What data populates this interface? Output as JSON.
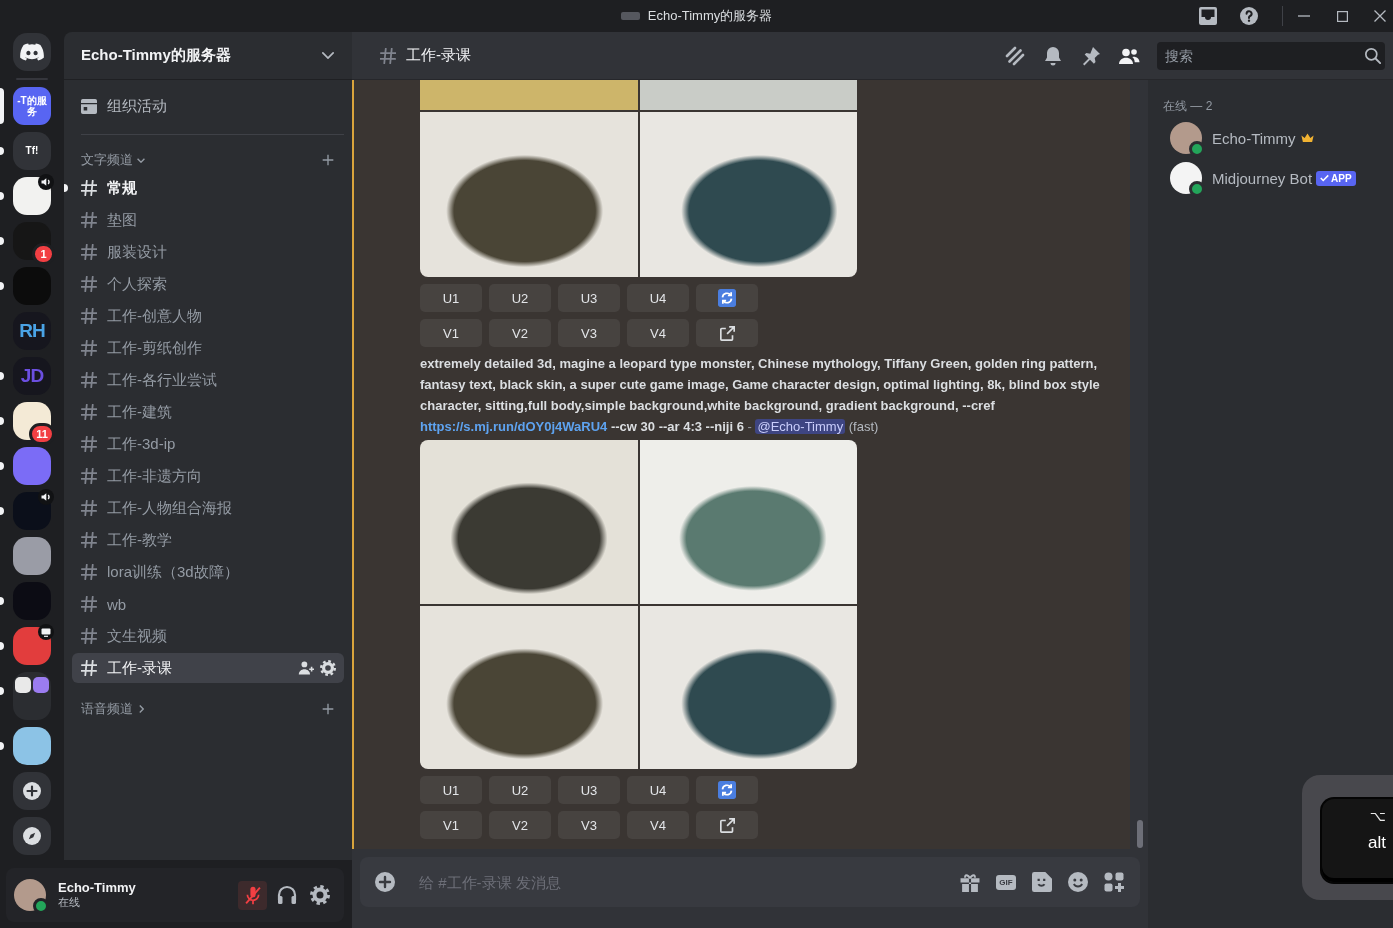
{
  "window": {
    "title": "Echo-Timmy的服务器"
  },
  "servers": [
    {
      "kind": "home",
      "selected": false,
      "unread": false,
      "voice": false,
      "screen": false
    },
    {
      "kind": "label",
      "label": "-T的服务",
      "color": "#5865f2",
      "selected": true,
      "unread": false,
      "voice": false,
      "screen": false
    },
    {
      "kind": "label",
      "label": "Tf!",
      "color": "#313338",
      "selected": false,
      "unread": true,
      "voice": false,
      "screen": false
    },
    {
      "kind": "image",
      "color": "#f2f2f0",
      "selected": false,
      "unread": true,
      "voice": true,
      "screen": false
    },
    {
      "kind": "image",
      "color": "#161616",
      "badge": "1",
      "selected": false,
      "unread": true,
      "voice": false,
      "screen": false
    },
    {
      "kind": "image",
      "color": "#0c0c0c",
      "selected": false,
      "unread": true,
      "voice": false,
      "screen": false
    },
    {
      "kind": "wordmark",
      "label": "RH",
      "color": "#4aa3e6",
      "selected": false,
      "unread": false,
      "voice": false,
      "screen": false
    },
    {
      "kind": "wordmark",
      "label": "JD",
      "color": "#6b4fe0",
      "selected": false,
      "unread": true,
      "voice": false,
      "screen": false
    },
    {
      "kind": "image",
      "color": "#f4ead6",
      "badge": "11",
      "selected": false,
      "unread": true,
      "voice": false,
      "screen": false
    },
    {
      "kind": "image",
      "color": "#7b6cf6",
      "selected": false,
      "unread": true,
      "voice": false,
      "screen": false
    },
    {
      "kind": "image",
      "color": "#0b0f1a",
      "selected": false,
      "unread": true,
      "voice": true,
      "screen": false
    },
    {
      "kind": "image",
      "color": "#9a9ca6",
      "selected": false,
      "unread": false,
      "voice": false,
      "screen": false
    },
    {
      "kind": "image",
      "color": "#0c0c14",
      "selected": false,
      "unread": true,
      "voice": false,
      "screen": false
    },
    {
      "kind": "image",
      "color": "#e23d3d",
      "selected": false,
      "unread": true,
      "voice": false,
      "screen": true
    },
    {
      "kind": "folder",
      "items": [
        {
          "color": "#e9e9e9"
        },
        {
          "color": "#9b7cf0"
        }
      ],
      "selected": false,
      "unread": true,
      "voice": false,
      "screen": false
    },
    {
      "kind": "image",
      "color": "#8cc3e6",
      "selected": false,
      "unread": true,
      "voice": false,
      "screen": false
    },
    {
      "kind": "add",
      "selected": false,
      "unread": false,
      "voice": false,
      "screen": false
    },
    {
      "kind": "discover",
      "selected": false,
      "unread": false,
      "voice": false,
      "screen": false
    }
  ],
  "sidebar": {
    "server_name": "Echo-Timmy的服务器",
    "event": "组织活动",
    "categories": [
      {
        "name": "文字频道",
        "expanded": true,
        "channels": [
          {
            "name": "常规",
            "unread": true,
            "selected": false
          },
          {
            "name": "垫图",
            "unread": false,
            "selected": false
          },
          {
            "name": "服装设计",
            "unread": false,
            "selected": false
          },
          {
            "name": "个人探索",
            "unread": false,
            "selected": false
          },
          {
            "name": "工作-创意人物",
            "unread": false,
            "selected": false
          },
          {
            "name": "工作-剪纸创作",
            "unread": false,
            "selected": false
          },
          {
            "name": "工作-各行业尝试",
            "unread": false,
            "selected": false
          },
          {
            "name": "工作-建筑",
            "unread": false,
            "selected": false
          },
          {
            "name": "工作-3d-ip",
            "unread": false,
            "selected": false
          },
          {
            "name": "工作-非遗方向",
            "unread": false,
            "selected": false
          },
          {
            "name": "工作-人物组合海报",
            "unread": false,
            "selected": false
          },
          {
            "name": "工作-教学",
            "unread": false,
            "selected": false
          },
          {
            "name": "lora训练（3d故障）",
            "unread": false,
            "selected": false
          },
          {
            "name": "wb",
            "unread": false,
            "selected": false
          },
          {
            "name": "文生视频",
            "unread": false,
            "selected": false
          },
          {
            "name": "工作-录课",
            "unread": false,
            "selected": true
          }
        ]
      },
      {
        "name": "语音频道",
        "expanded": false
      }
    ]
  },
  "user": {
    "name": "Echo-Timmy",
    "status": "在线",
    "online": true,
    "muted": true
  },
  "header": {
    "channel": "工作-录课",
    "members_open": true,
    "search_placeholder": "搜索"
  },
  "message": {
    "highlighted": true,
    "blocks": [
      {
        "kind": "grid",
        "cropped": true
      },
      {
        "kind": "buttons",
        "rows": [
          [
            {
              "kind": "text",
              "label": "U1"
            },
            {
              "kind": "text",
              "label": "U2"
            },
            {
              "kind": "text",
              "label": "U3"
            },
            {
              "kind": "text",
              "label": "U4"
            },
            {
              "kind": "refresh"
            }
          ],
          [
            {
              "kind": "text",
              "label": "V1"
            },
            {
              "kind": "text",
              "label": "V2"
            },
            {
              "kind": "text",
              "label": "V3"
            },
            {
              "kind": "text",
              "label": "V4"
            },
            {
              "kind": "external"
            }
          ]
        ]
      },
      {
        "kind": "prompt",
        "text": "extremely detailed 3d, magine a leopard type monster, Chinese mythology, Tiffany Green, golden ring pattern, fantasy text, black skin, a super cute game image, Game character design, optimal lighting, 8k, blind box style character, sitting,full body,simple background,white background, gradient background, --cref",
        "link": "https://s.mj.run/dOY0j4WaRU4",
        "params": "--cw 30 --ar 4:3 --niji 6",
        "separator": "-",
        "mention": "@Echo-Timmy",
        "speed": "(fast)"
      },
      {
        "kind": "grid",
        "cropped": false
      },
      {
        "kind": "buttons",
        "rows": [
          [
            {
              "kind": "text",
              "label": "U1"
            },
            {
              "kind": "text",
              "label": "U2"
            },
            {
              "kind": "text",
              "label": "U3"
            },
            {
              "kind": "text",
              "label": "U4"
            },
            {
              "kind": "refresh"
            }
          ],
          [
            {
              "kind": "text",
              "label": "V1"
            },
            {
              "kind": "text",
              "label": "V2"
            },
            {
              "kind": "text",
              "label": "V3"
            },
            {
              "kind": "text",
              "label": "V4"
            },
            {
              "kind": "external"
            }
          ]
        ]
      }
    ]
  },
  "composer": {
    "placeholder": "给 #工作-录课 发消息",
    "gif_label": "GIF"
  },
  "members": {
    "heading": "在线 — 2",
    "list": [
      {
        "name": "Echo-Timmy",
        "owner": true,
        "online": true
      },
      {
        "name": "Midjourney Bot",
        "owner": false,
        "online": true,
        "badge": "APP"
      }
    ]
  },
  "key_overlay": {
    "symbol": "⌥",
    "label": "alt"
  }
}
